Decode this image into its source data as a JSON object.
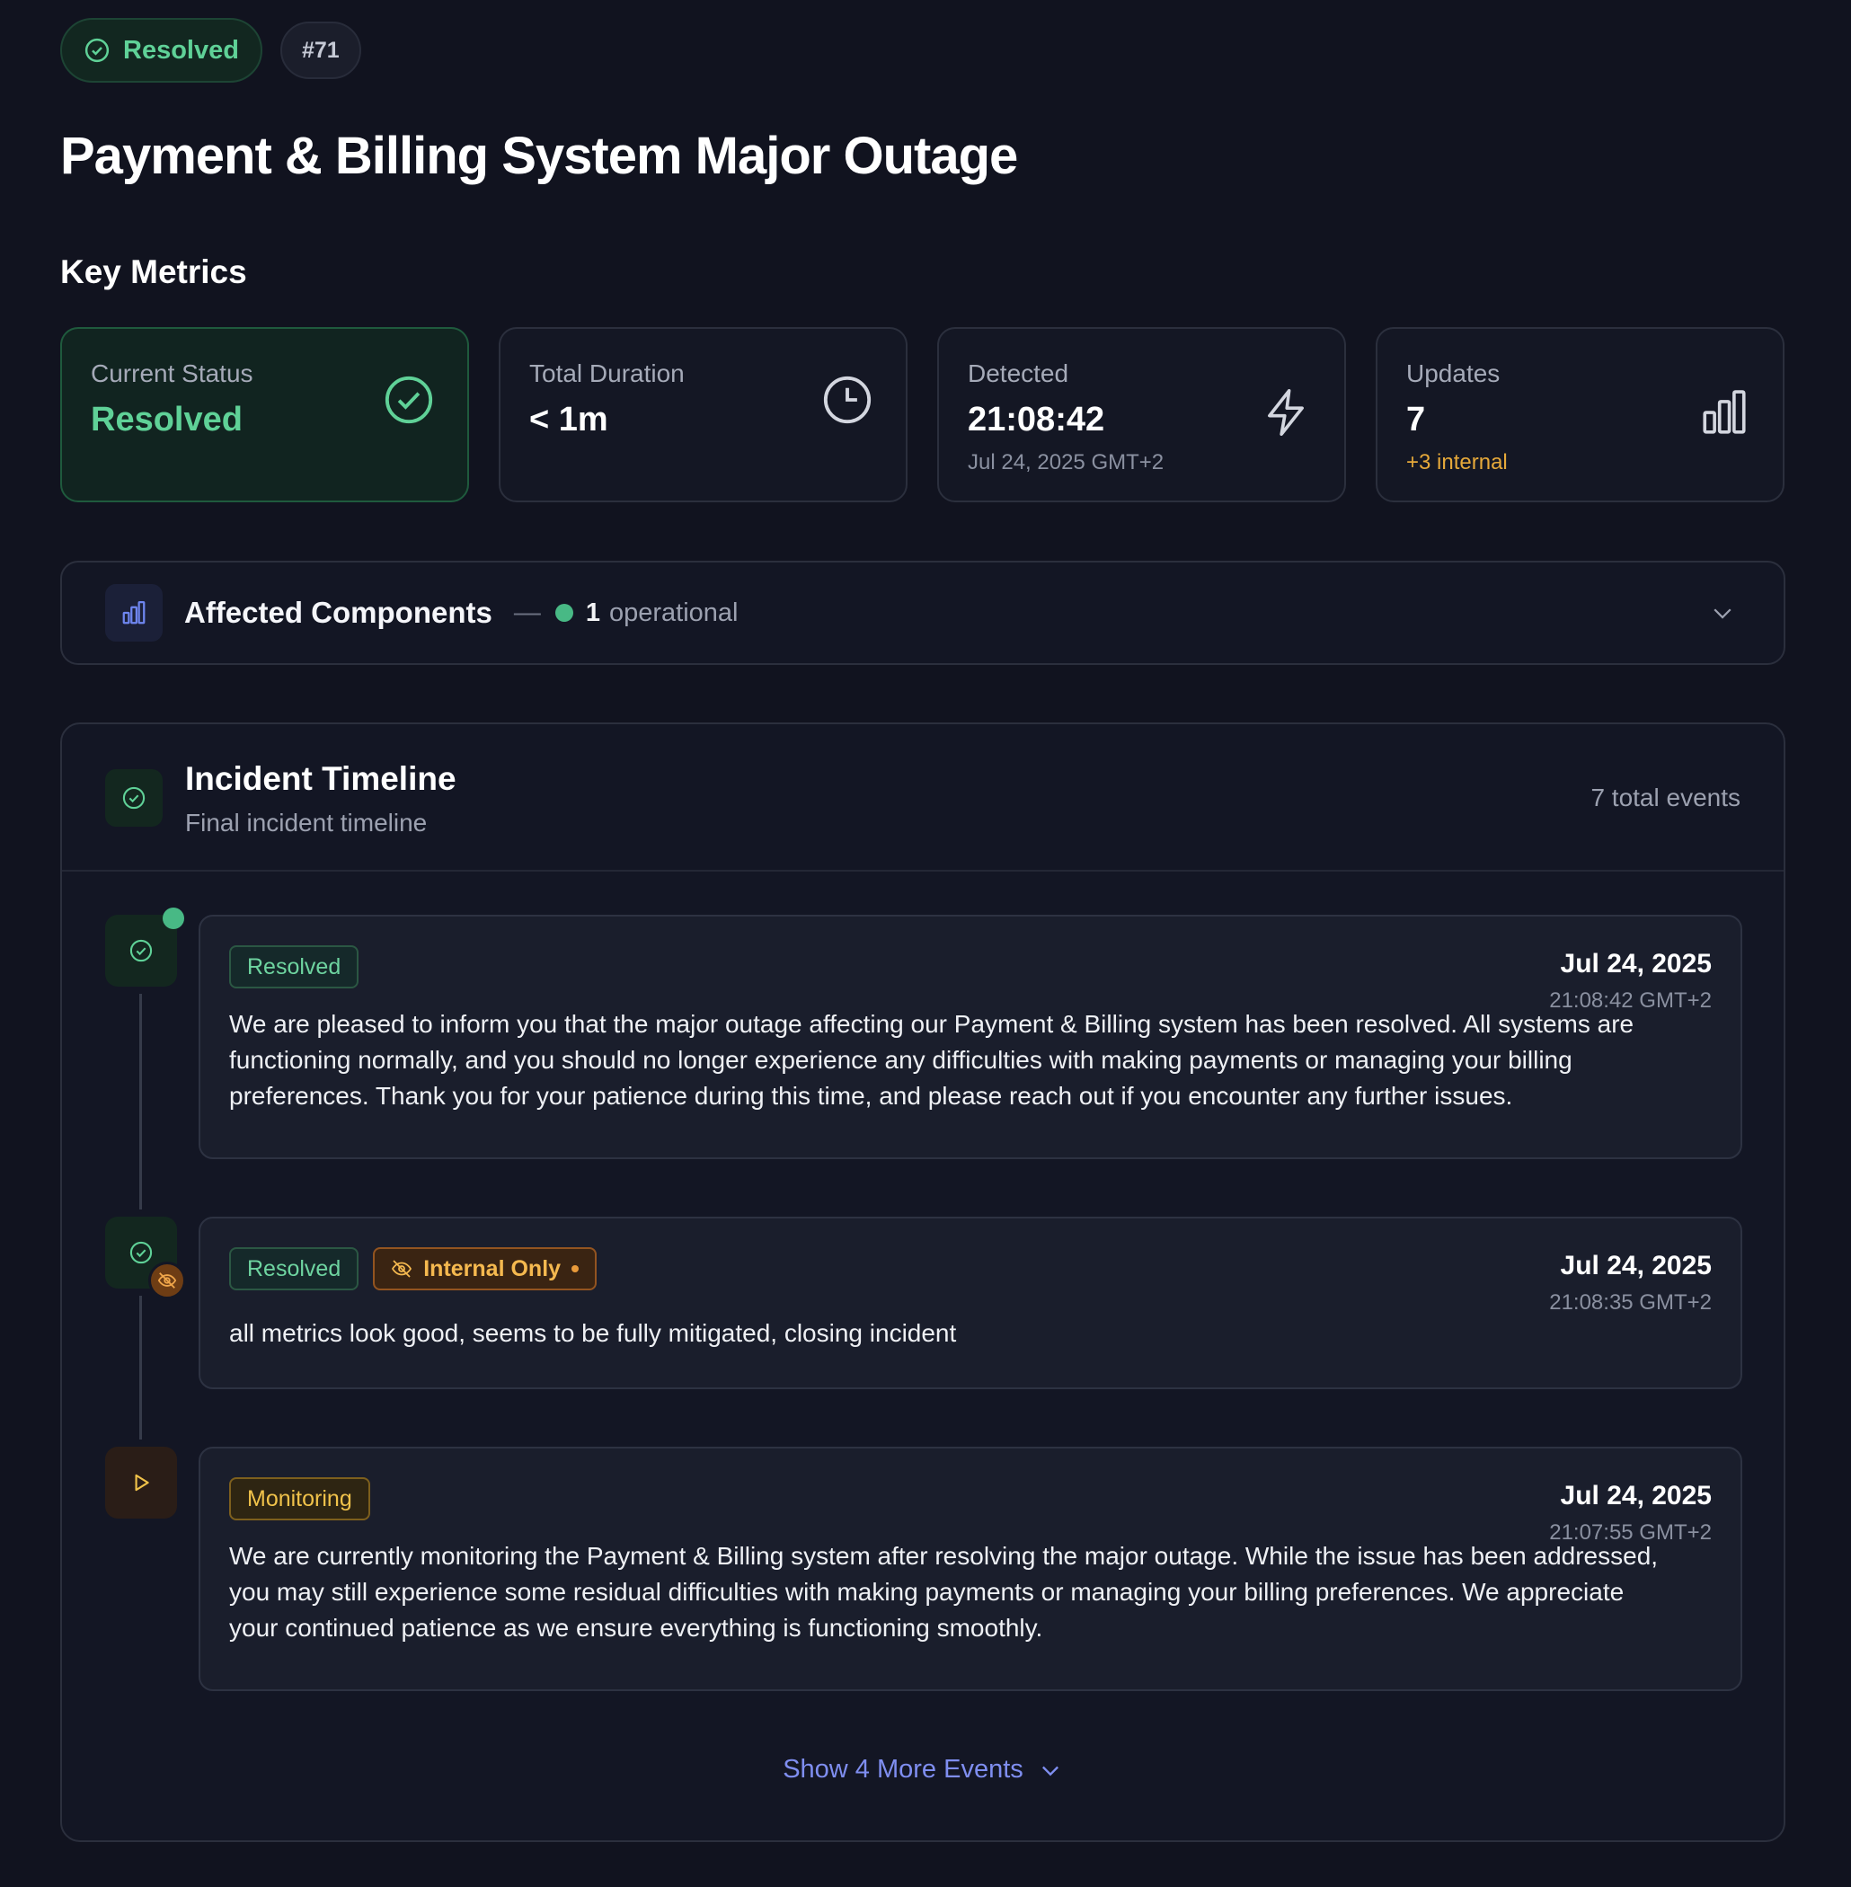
{
  "header": {
    "status_label": "Resolved",
    "incident_id": "#71",
    "title": "Payment & Billing System Major Outage"
  },
  "key_metrics": {
    "section_title": "Key Metrics",
    "cards": [
      {
        "label": "Current Status",
        "value": "Resolved",
        "sub": "",
        "icon": "check-circle-icon"
      },
      {
        "label": "Total Duration",
        "value": "< 1m",
        "sub": "",
        "icon": "clock-icon"
      },
      {
        "label": "Detected",
        "value": "21:08:42",
        "sub": "Jul 24, 2025 GMT+2",
        "icon": "lightning-icon"
      },
      {
        "label": "Updates",
        "value": "7",
        "sub": "+3 internal",
        "icon": "bar-chart-icon"
      }
    ]
  },
  "affected": {
    "title": "Affected Components",
    "dash": "—",
    "count": "1",
    "status_word": "operational"
  },
  "timeline": {
    "title": "Incident Timeline",
    "subtitle": "Final incident timeline",
    "count_label": "7 total events",
    "events": [
      {
        "badge": "Resolved",
        "internal_label": "",
        "date": "Jul 24, 2025",
        "time": "21:08:42 GMT+2",
        "text": "We are pleased to inform you that the major outage affecting our Payment & Billing system has been resolved. All systems are functioning normally, and you should no longer experience any difficulties with making payments or managing your billing preferences. Thank you for your patience during this time, and please reach out if you encounter any further issues."
      },
      {
        "badge": "Resolved",
        "internal_label": "Internal Only",
        "date": "Jul 24, 2025",
        "time": "21:08:35 GMT+2",
        "text": "all metrics look good, seems to be fully mitigated, closing incident"
      },
      {
        "badge": "Monitoring",
        "internal_label": "",
        "date": "Jul 24, 2025",
        "time": "21:07:55 GMT+2",
        "text": "We are currently monitoring the Payment & Billing system after resolving the major outage. While the issue has been addressed, you may still experience some residual difficulties with making payments or managing your billing preferences. We appreciate your continued patience as we ensure everything is functioning smoothly."
      }
    ],
    "show_more_label": "Show 4 More Events"
  },
  "colors": {
    "background": "#11131f",
    "success": "#5fd197",
    "warning": "#f0c24a",
    "accent": "#7f8ef0"
  }
}
